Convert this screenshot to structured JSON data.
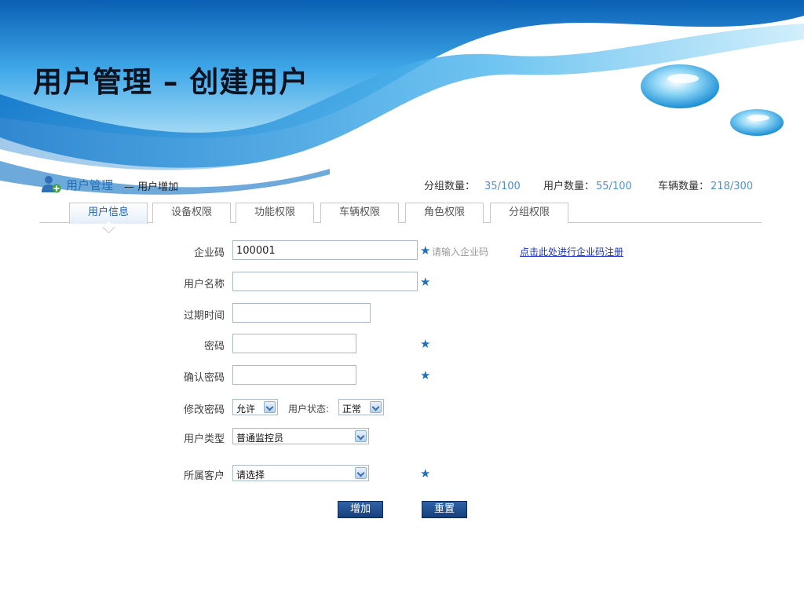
{
  "slide": {
    "title": "用户管理 – 创建用户"
  },
  "module": {
    "title": "用户管理",
    "subtitle": "— 用户增加",
    "stats": {
      "groups_label": "分组数量：",
      "groups_value": "35/100",
      "users_label": "用户数量：",
      "users_value": "55/100",
      "vehicles_label": "车辆数量：",
      "vehicles_value": "218/300"
    }
  },
  "tabs": [
    "用户信息",
    "设备权限",
    "功能权限",
    "车辆权限",
    "角色权限",
    "分组权限"
  ],
  "form": {
    "company_code": {
      "label": "企业码",
      "value": "100001",
      "hint": "请输入企业码",
      "register_link": "点击此处进行企业码注册"
    },
    "user_name": {
      "label": "用户名称",
      "value": ""
    },
    "expire_time": {
      "label": "过期时间",
      "value": ""
    },
    "password": {
      "label": "密码",
      "value": ""
    },
    "confirm_password": {
      "label": "确认密码",
      "value": ""
    },
    "change_password": {
      "label": "修改密码",
      "value": "允许"
    },
    "user_status": {
      "label": "用户状态:",
      "value": "正常"
    },
    "user_type": {
      "label": "用户类型",
      "value": "普通监控员"
    },
    "customer": {
      "label": "所属客户",
      "value": "请选择"
    },
    "colon": "：",
    "required_star": "★"
  },
  "buttons": {
    "add": "增加",
    "reset": "重置"
  },
  "colors": {
    "accent": "#1f6fbf",
    "button": "#1f4f90",
    "link": "#1a33c8"
  }
}
